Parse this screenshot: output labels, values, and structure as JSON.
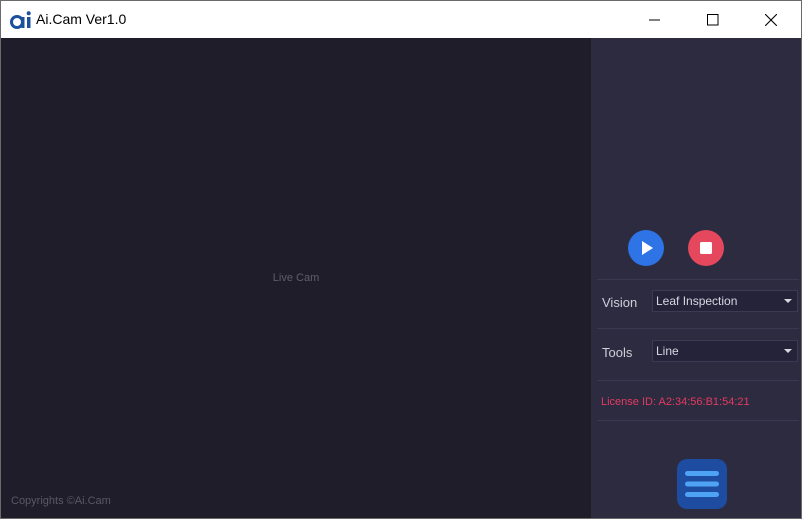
{
  "window": {
    "title": "Ai.Cam Ver1.0",
    "logo_icon": "ai-logo-icon",
    "controls": [
      "minimize-icon",
      "maximize-icon",
      "close-icon"
    ]
  },
  "live": {
    "label": "Live Cam",
    "copyright": "Copyrights ©Ai.Cam"
  },
  "controls": {
    "play_icon": "play-icon",
    "stop_icon": "stop-icon",
    "play_color": "#2f74e6",
    "stop_color": "#e5485c"
  },
  "vision": {
    "label": "Vision",
    "selected": "Leaf Inspection"
  },
  "tools": {
    "label": "Tools",
    "selected": "Line"
  },
  "license": {
    "text": "License ID: A2:34:56:B1:54:21",
    "color": "#e43a61"
  },
  "menu": {
    "icon": "hamburger-menu-icon",
    "color": "#1d4ca0"
  }
}
